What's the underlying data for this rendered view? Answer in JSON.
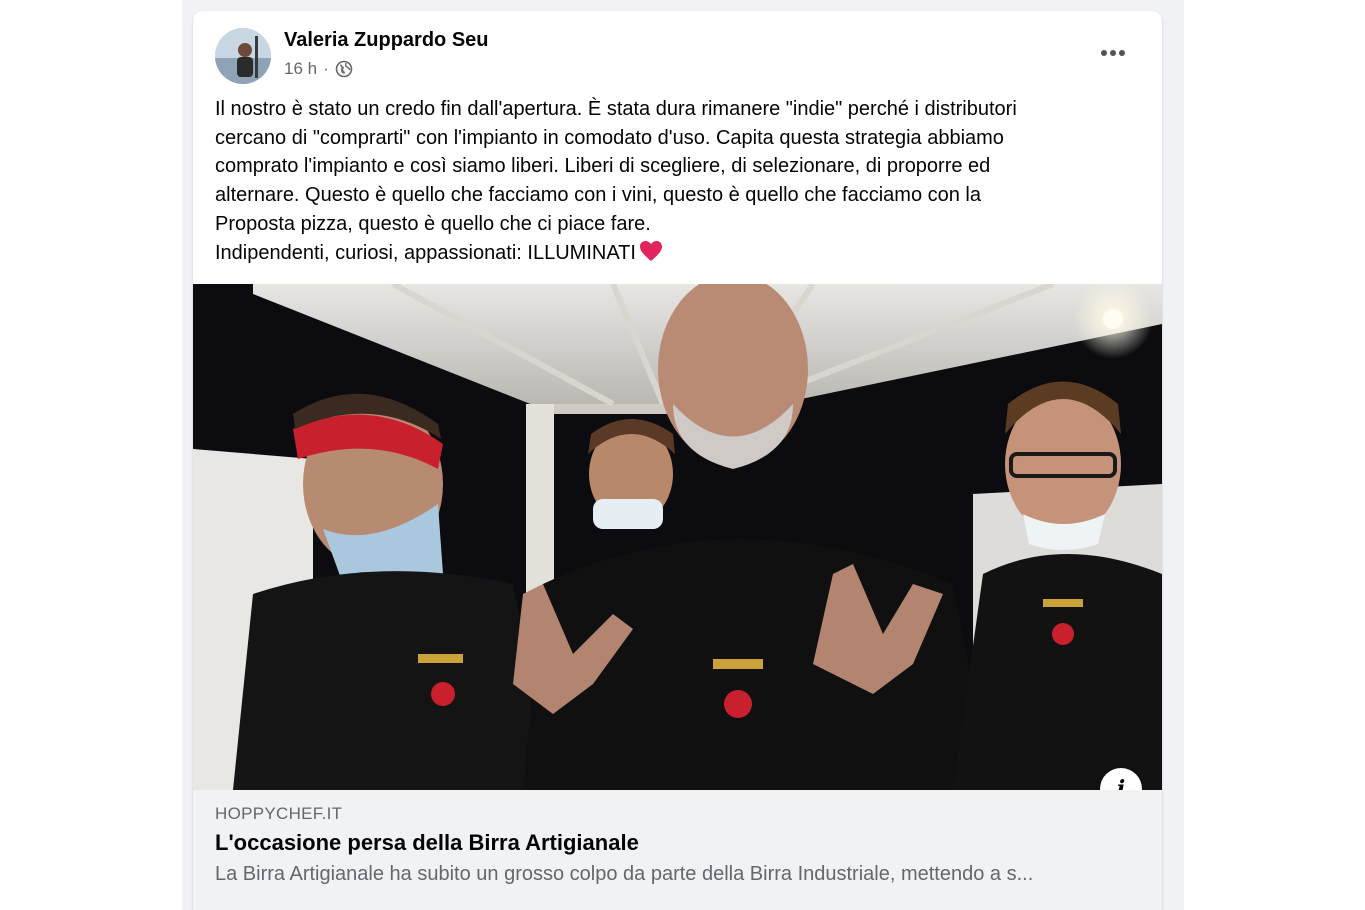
{
  "post": {
    "author": "Valeria Zuppardo Seu",
    "time": "16 h",
    "separator": "·",
    "privacy_icon": "globe-icon",
    "more_icon": "more-options-icon",
    "text_lines": [
      "Il nostro è stato un credo fin dall'apertura. È stata dura rimanere \"indie\" perché i distributori",
      "cercano di \"comprarti\" con l'impianto in comodato d'uso. Capita questa strategia abbiamo",
      "comprato l'impianto e così siamo liberi. Liberi di scegliere, di selezionare, di proporre ed",
      "alternare. Questo è quello che facciamo con i vini, questo è quello che facciamo con la",
      "Proposta pizza, questo è quello che ci piace fare.",
      "Indipendenti, curiosi, appassionati: ILLUMINATI"
    ],
    "emoji": "red-heart-icon"
  },
  "link_preview": {
    "domain": "HOPPYCHEF.IT",
    "title": "L'occasione persa della Birra Artigianale",
    "description": "La Birra Artigianale ha subito un grosso colpo da parte della Birra Industriale, mettendo a s...",
    "info_label": "i"
  },
  "colors": {
    "page_bg": "#ffffff",
    "feed_bg": "#f0f2f5",
    "card_bg": "#ffffff",
    "primary_text": "#050505",
    "secondary_text": "#65676b",
    "heart": "#e0245e"
  }
}
